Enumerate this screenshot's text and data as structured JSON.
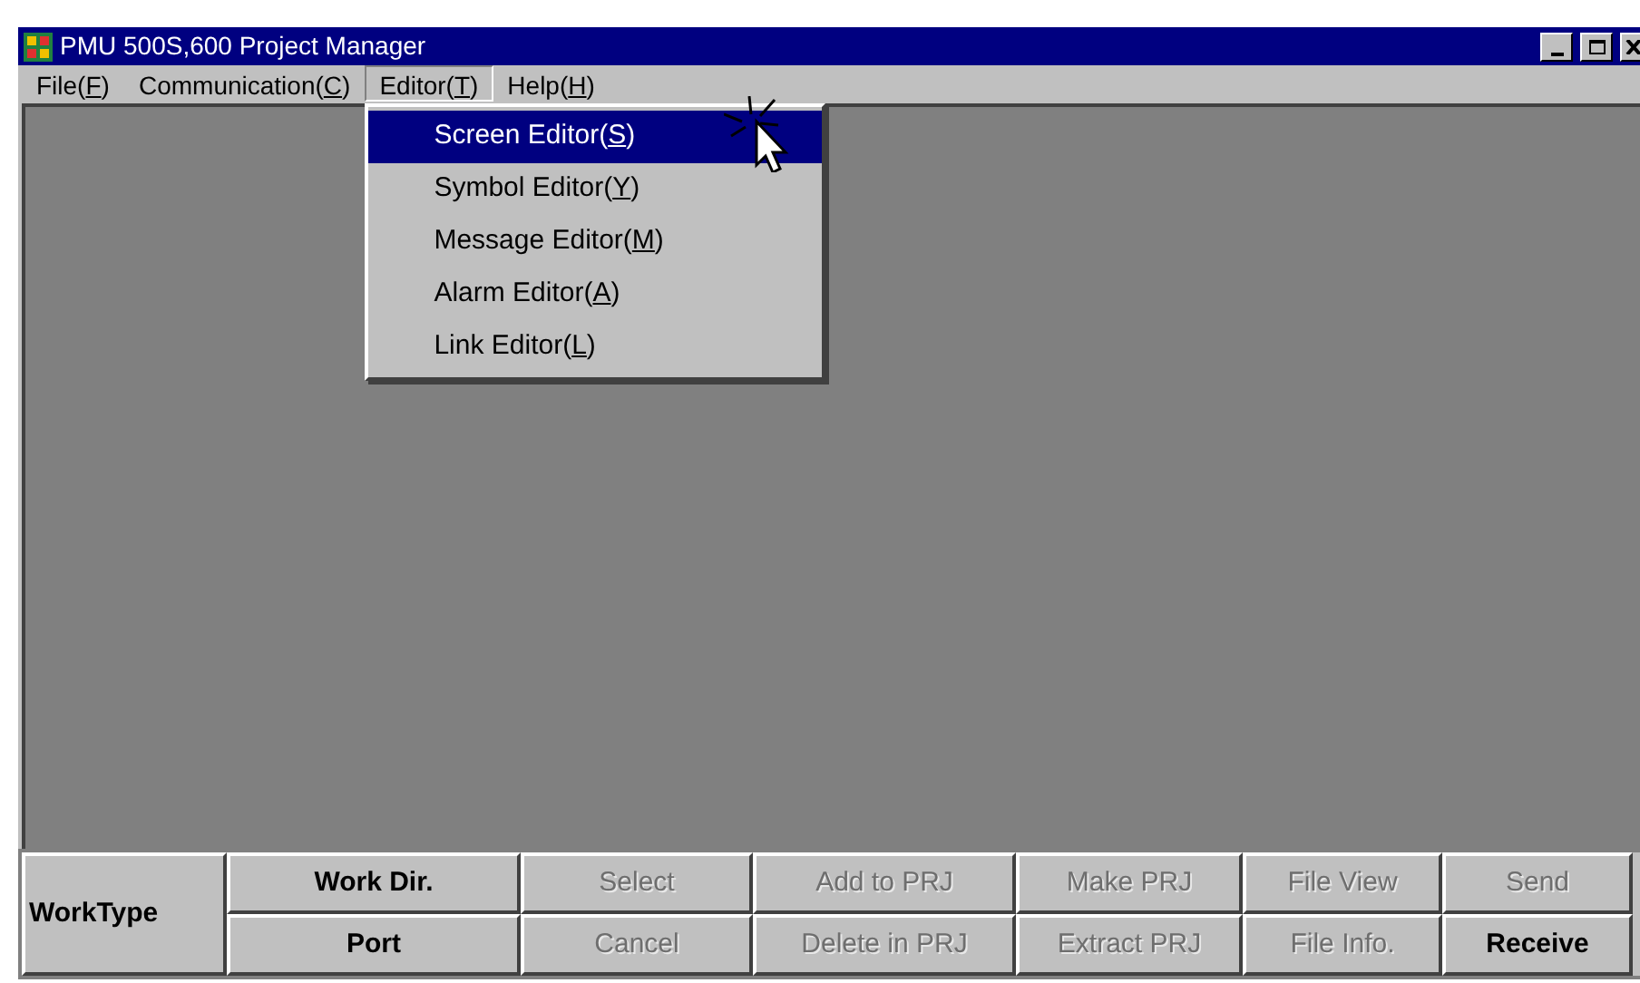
{
  "window": {
    "title": "PMU 500S,600 Project Manager"
  },
  "menu_bar": [
    {
      "text": "File(",
      "key": "F",
      "end": ")",
      "selected": false
    },
    {
      "text": "Communication(",
      "key": "C",
      "end": ")",
      "selected": false
    },
    {
      "text": "Editor(",
      "key": "T",
      "end": ")",
      "selected": true
    },
    {
      "text": "Help(",
      "key": "H",
      "end": ")",
      "selected": false
    }
  ],
  "dropdown": [
    {
      "text": "Screen Editor(",
      "key": "S",
      "end": ")",
      "selected": true
    },
    {
      "text": "Symbol Editor(",
      "key": "Y",
      "end": ")",
      "selected": false
    },
    {
      "text": "Message Editor(",
      "key": "M",
      "end": ")",
      "selected": false
    },
    {
      "text": "Alarm Editor(",
      "key": "A",
      "end": ")",
      "selected": false
    },
    {
      "text": "Link Editor(",
      "key": "L",
      "end": ")",
      "selected": false
    }
  ],
  "toolbar": {
    "label": "WorkType",
    "buttons": [
      [
        {
          "label": "Work Dir.",
          "disabled": false
        },
        {
          "label": "Select",
          "disabled": true
        },
        {
          "label": "Add to PRJ",
          "disabled": true
        },
        {
          "label": "Make PRJ",
          "disabled": true
        },
        {
          "label": "File View",
          "disabled": true
        },
        {
          "label": "Send",
          "disabled": true
        }
      ],
      [
        {
          "label": "Port",
          "disabled": false
        },
        {
          "label": "Cancel",
          "disabled": true
        },
        {
          "label": "Delete in PRJ",
          "disabled": true
        },
        {
          "label": "Extract PRJ",
          "disabled": true
        },
        {
          "label": "File Info.",
          "disabled": true
        },
        {
          "label": "Receive",
          "disabled": false
        }
      ]
    ]
  }
}
